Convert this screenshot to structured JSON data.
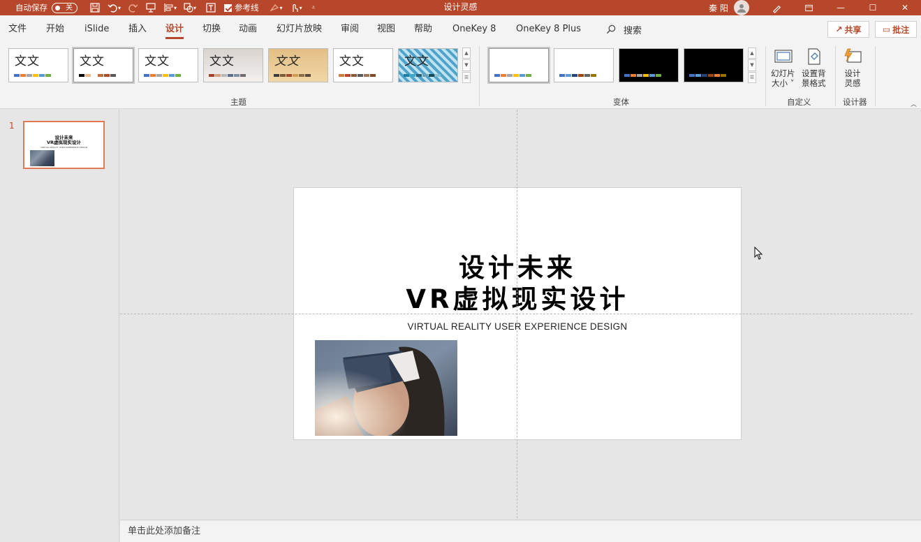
{
  "titlebar": {
    "autosave_label": "自动保存",
    "autosave_state": "关",
    "guides_label": "参考线",
    "doc_title": "设计灵感",
    "user_name": "秦 阳",
    "minimize": "—",
    "maximize": "☐",
    "close": "✕"
  },
  "tabs": [
    "文件",
    "开始",
    "iSlide",
    "插入",
    "设计",
    "切换",
    "动画",
    "幻灯片放映",
    "审阅",
    "视图",
    "帮助",
    "OneKey 8",
    "OneKey 8 Plus"
  ],
  "active_tab": "设计",
  "search_label": "搜索",
  "share_label": "共享",
  "comment_label": "批注",
  "ribbon": {
    "themes_group": "主题",
    "variants_group": "变体",
    "customize_group": "自定义",
    "designer_group": "设计器",
    "theme_sample_text": "文文",
    "slide_size_label": "幻灯片大小",
    "slide_size_line1": "幻灯片",
    "slide_size_line2": "大小 ˅",
    "format_bg_line1": "设置背",
    "format_bg_line2": "景格式",
    "design_ideas_line1": "设计",
    "design_ideas_line2": "灵感"
  },
  "slides_pane": {
    "slide_number": "1",
    "thumb_title_line1": "设计未来",
    "thumb_title_line2": "VR虚拟现实设计",
    "thumb_subtitle": "VIRTUAL REALITY USER EXPERIENCE DESIGN"
  },
  "slide": {
    "title_line1": "设计未来",
    "title_line2": "VR虚拟现实设计",
    "subtitle": "VIRTUAL REALITY USER EXPERIENCE DESIGN"
  },
  "notes_placeholder": "单击此处添加备注",
  "colors": {
    "accent": "#b7472a",
    "slide_selection": "#e07a55"
  }
}
